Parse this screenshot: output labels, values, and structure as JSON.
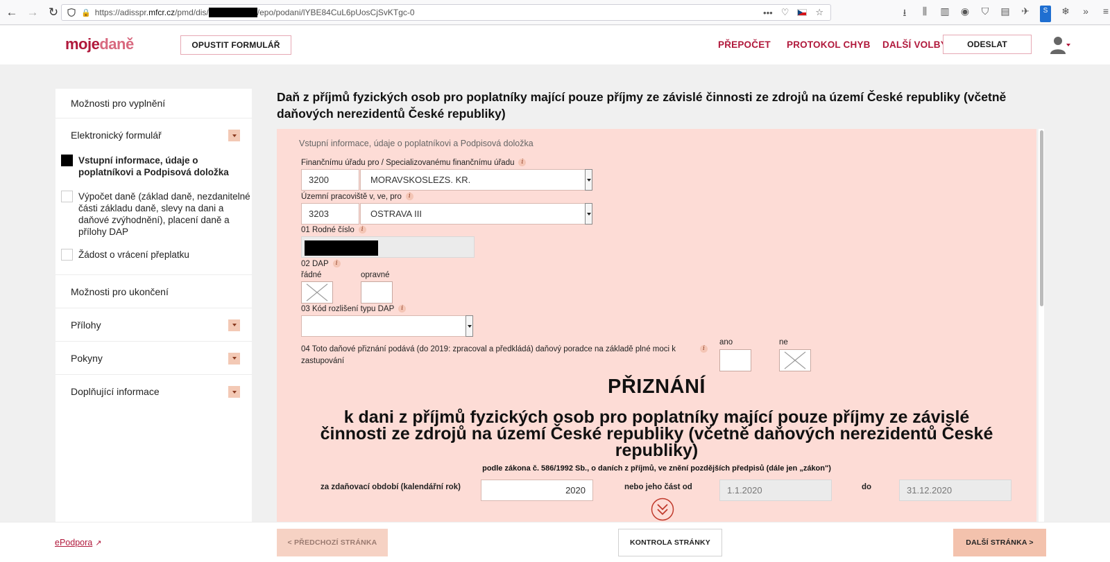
{
  "browser": {
    "url_prefix": "https://adisspr.",
    "url_domain": "mfcr.cz",
    "url_path1": "/pmd/dis/",
    "url_path2": "/epo/podani/lYBE84CuL6pUosCjSvKTgc-0",
    "more_label": "•••"
  },
  "header": {
    "logo_moje": "moje",
    "logo_dane": "daně",
    "leave_form": "OPUSTIT FORMULÁŘ",
    "recalc": "PŘEPOČET",
    "error_log": "PROTOKOL CHYB",
    "more_options": "DALŠÍ VOLBY",
    "send": "ODESLAT"
  },
  "sidebar": {
    "fill_options": "Možnosti pro vyplnění",
    "electronic_form": "Elektronický formulář",
    "sub_items": [
      {
        "label": "Vstupní informace, údaje o poplatníkovi a Podpisová doložka",
        "active": true
      },
      {
        "label": "Výpočet daně (základ daně, nezdanitelné části základu daně, slevy na dani a daňové zvýhodnění), placení daně a přílohy DAP",
        "active": false
      },
      {
        "label": "Žádost o vrácení přeplatku",
        "active": false
      }
    ],
    "end_options": "Možnosti pro ukončení",
    "attachments": "Přílohy",
    "instructions": "Pokyny",
    "additional_info": "Doplňující informace"
  },
  "main": {
    "title": "Daň z příjmů fyzických osob pro poplatníky mající pouze příjmy ze závislé činnosti ze zdrojů na území České republiky (včetně daňových nerezidentů České republiky)",
    "section_title": "Vstupní informace, údaje o poplatníkovi a Podpisová doložka",
    "tax_office_label": "Finančnímu úřadu pro / Specializovanému finančnímu úřadu",
    "tax_office_code": "3200",
    "tax_office_name": "MORAVSKOSLEZS. KR.",
    "territorial_label": "Územní pracoviště v, ve, pro",
    "territorial_code": "3203",
    "territorial_name": "OSTRAVA III",
    "birth_number_label": "01 Rodné číslo",
    "dap_label": "02 DAP",
    "dap_regular": "řádné",
    "dap_corrective": "opravné",
    "dap_type_label": "03 Kód rozlišení typu DAP",
    "advisor_label": "04 Toto daňové přiznání podává (do 2019: zpracoval a předkládá) daňový poradce na základě plné moci k zastupování",
    "yes": "ano",
    "no": "ne",
    "doc_title": "PŘIZNÁNÍ",
    "doc_subtitle": "k dani z příjmů fyzických osob pro poplatníky mající pouze příjmy ze závislé činnosti ze zdrojů na území České republiky (včetně daňových nerezidentů České republiky)",
    "law_text": "podle zákona č. 586/1992 Sb., o daních z příjmů, ve znění pozdějších předpisů (dále jen „zákon\")",
    "period_label": "za zdaňovací období (kalendářní rok)",
    "period_year": "2020",
    "or_part_from": "nebo jeho část od",
    "date_from": "1.1.2020",
    "to_label": "do",
    "date_to": "31.12.2020"
  },
  "footer": {
    "support": "ePodpora",
    "prev": "< PŘEDCHOZÍ STRÁNKA",
    "check": "KONTROLA STRÁNKY",
    "next": "DALŠÍ STRÁNKA >"
  },
  "icons": {
    "back": "back-arrow-icon",
    "forward": "forward-arrow-icon",
    "reload": "reload-icon",
    "user": "user-icon",
    "scroll_down": "double-chevron-down-icon"
  },
  "colors": {
    "brand": "#b0183b",
    "panel": "#fddcd6",
    "accent": "#f3c2ad"
  }
}
